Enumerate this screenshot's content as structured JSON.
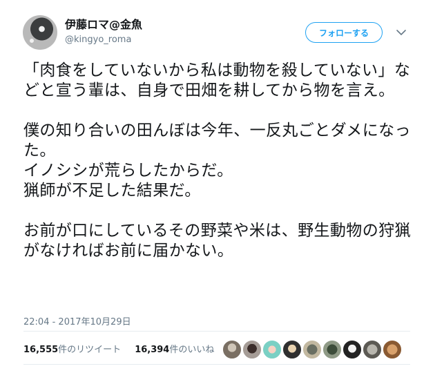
{
  "author": {
    "display_name": "伊藤ロマ@金魚",
    "handle": "@kingyo_roma"
  },
  "follow_button": {
    "label": "フォローする"
  },
  "tweet": {
    "text": "「肉食をしていないから私は動物を殺していない」などと宣う輩は、自身で田畑を耕してから物を言え。\n\n僕の知り合いの田んぼは今年、一反丸ごとダメになった。\nイノシシが荒らしたからだ。\n猟師が不足した結果だ。\n\nお前が口にしているその野菜や米は、野生動物の狩猟がなければお前に届かない。",
    "timestamp": "22:04 - 2017年10月29日"
  },
  "stats": {
    "retweets_count": "16,555",
    "retweets_label": "件のリツイート",
    "likes_count": "16,394",
    "likes_label": "件のいいね"
  },
  "colors": {
    "accent": "#1da1f2",
    "muted_text": "#657786",
    "divider": "#e6ecf0"
  },
  "liker_avatars": [
    "avatar-1",
    "avatar-2",
    "avatar-3",
    "avatar-4",
    "avatar-5",
    "avatar-6",
    "avatar-7",
    "avatar-8",
    "avatar-9"
  ]
}
